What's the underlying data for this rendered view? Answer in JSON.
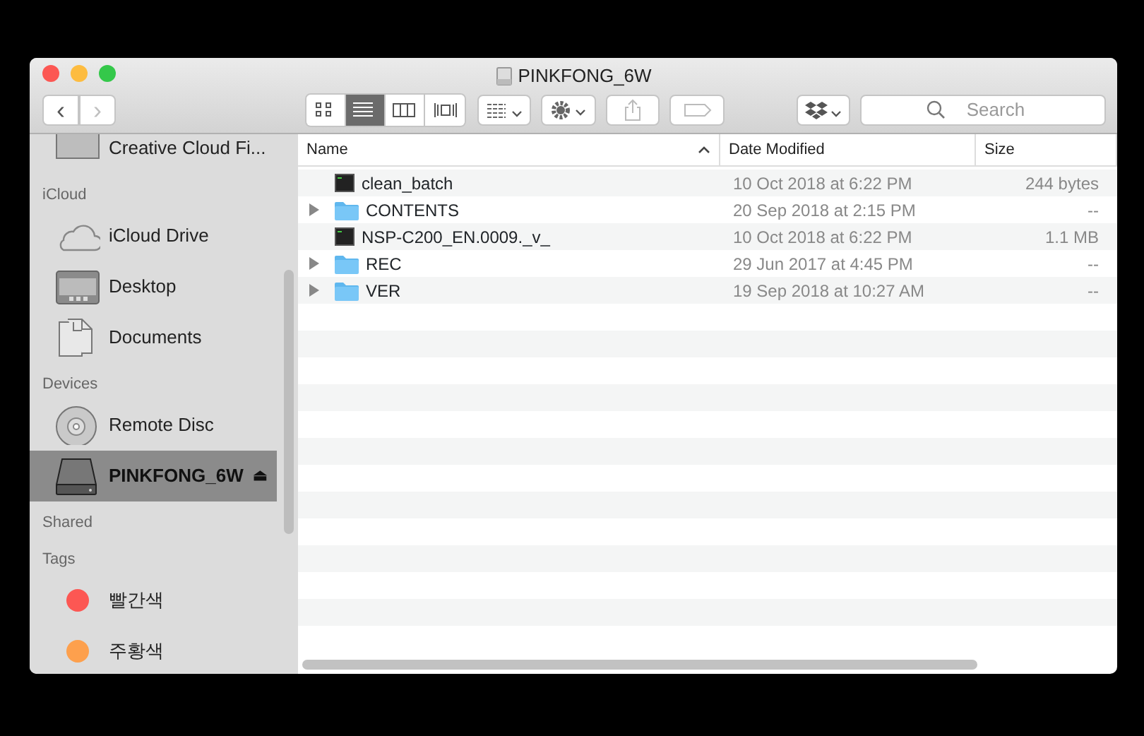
{
  "window": {
    "title": "PINKFONG_6W"
  },
  "toolbar": {
    "nav": [
      {
        "label": "‹",
        "disabled": false
      },
      {
        "label": "›",
        "disabled": true
      }
    ],
    "views": [
      {
        "kind": "icons",
        "selected": false
      },
      {
        "kind": "list",
        "selected": true
      },
      {
        "kind": "columns",
        "selected": false
      },
      {
        "kind": "coverflow",
        "selected": false
      }
    ],
    "search": {
      "placeholder": "Search"
    }
  },
  "sidebar": {
    "items": [
      {
        "kind": "drive",
        "label": "Creative Cloud Fi...",
        "selected": false
      },
      {
        "kind": "header",
        "label": "iCloud"
      },
      {
        "kind": "cloud",
        "label": "iCloud Drive",
        "selected": false
      },
      {
        "kind": "desktop",
        "label": "Desktop",
        "selected": false
      },
      {
        "kind": "documents",
        "label": "Documents",
        "selected": false
      },
      {
        "kind": "header",
        "label": "Devices"
      },
      {
        "kind": "disc",
        "label": "Remote Disc",
        "selected": false
      },
      {
        "kind": "external",
        "label": "PINKFONG_6W",
        "selected": true,
        "eject": "⏏"
      },
      {
        "kind": "header",
        "label": "Shared"
      },
      {
        "kind": "header",
        "label": "Tags"
      },
      {
        "kind": "tag",
        "label": "빨간색",
        "color": "#fc5753",
        "selected": false
      },
      {
        "kind": "tag",
        "label": "주황색",
        "color": "#fda04d",
        "selected": false
      }
    ]
  },
  "table": {
    "columns": [
      {
        "label": "Name",
        "sorted": true
      },
      {
        "label": "Date Modified",
        "sorted": false
      },
      {
        "label": "Size",
        "sorted": false
      }
    ],
    "rows": [
      {
        "kind": "file",
        "name": "clean_batch",
        "date": "10 Oct 2018 at 6:22 PM",
        "size": "244 bytes"
      },
      {
        "kind": "folder",
        "name": "CONTENTS",
        "date": "20 Sep 2018 at 2:15 PM",
        "size": "--"
      },
      {
        "kind": "file",
        "name": "NSP-C200_EN.0009._v_",
        "date": "10 Oct 2018 at 6:22 PM",
        "size": "1.1 MB"
      },
      {
        "kind": "folder",
        "name": "REC",
        "date": "29 Jun 2017 at 4:45 PM",
        "size": "--"
      },
      {
        "kind": "folder",
        "name": "VER",
        "date": "19 Sep 2018 at 10:27 AM",
        "size": "--"
      }
    ]
  }
}
